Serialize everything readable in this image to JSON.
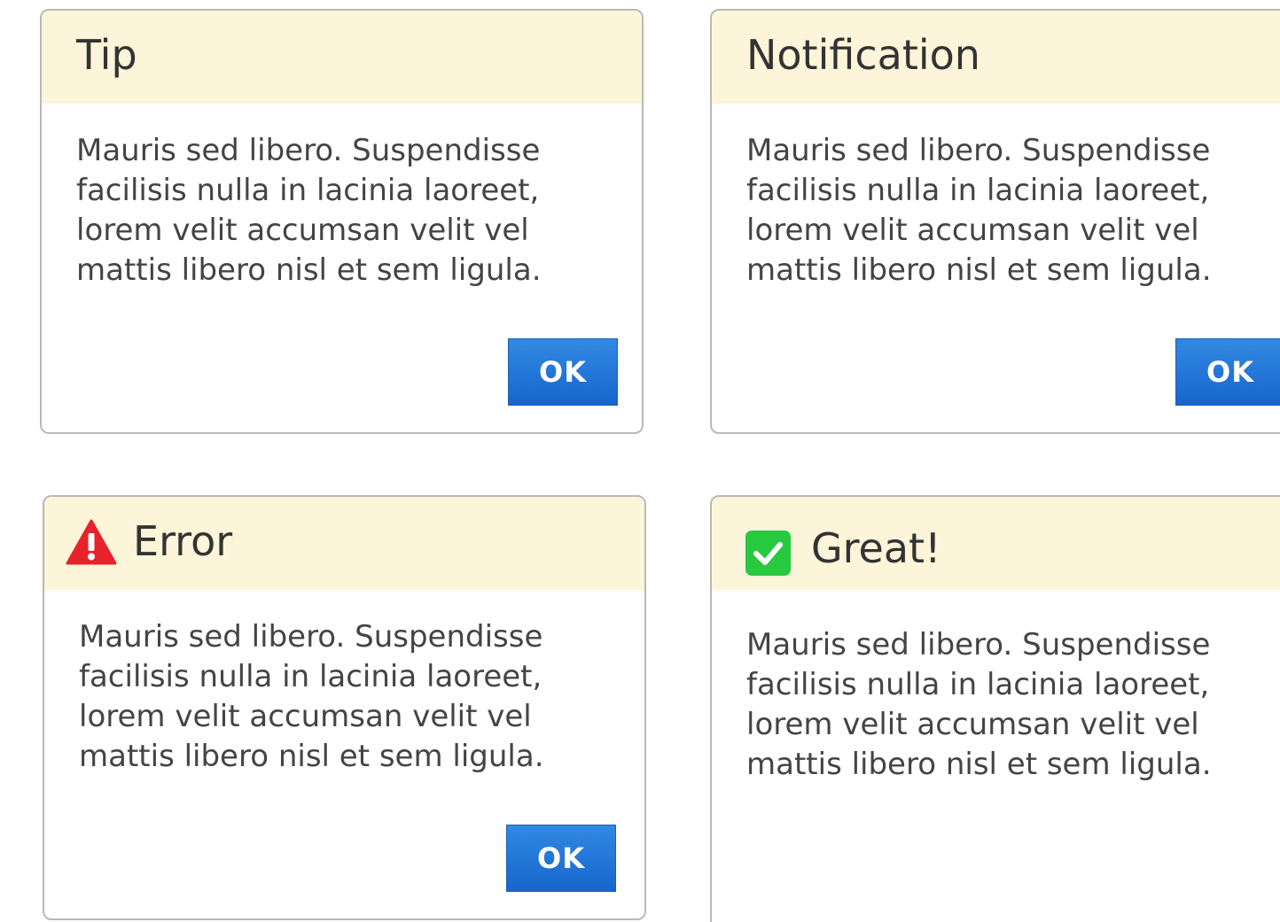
{
  "dialogs": {
    "tip": {
      "title": "Tip",
      "body_lines": [
        "Mauris sed libero. Suspendisse",
        "facilisis nulla in lacinia laoreet,",
        "lorem velit accumsan velit vel",
        "mattis libero nisl et sem ligula."
      ],
      "ok_label": "OK"
    },
    "notification": {
      "title": "Notification",
      "body_lines": [
        "Mauris sed libero. Suspendisse",
        "facilisis nulla in lacinia laoreet,",
        "lorem velit accumsan velit vel",
        "mattis libero nisl et sem ligula."
      ],
      "ok_label": "OK"
    },
    "error": {
      "title": "Error",
      "icon": "warning-triangle-icon",
      "body_lines": [
        "Mauris sed libero. Suspendisse",
        "facilisis nulla in lacinia laoreet,",
        "lorem velit accumsan velit vel",
        "mattis libero nisl et sem ligula."
      ],
      "ok_label": "OK"
    },
    "great": {
      "title": "Great!",
      "icon": "checkmark-icon",
      "body_lines": [
        "Mauris sed libero. Suspendisse",
        "facilisis nulla in lacinia laoreet,",
        "lorem velit accumsan velit vel",
        "mattis libero nisl et sem ligula."
      ]
    }
  },
  "colors": {
    "header_background": "#fcf5d9",
    "button_blue": "#1e73d8",
    "error_red": "#e8222a",
    "success_green": "#27c93f",
    "border_gray": "#b8b8b8"
  }
}
